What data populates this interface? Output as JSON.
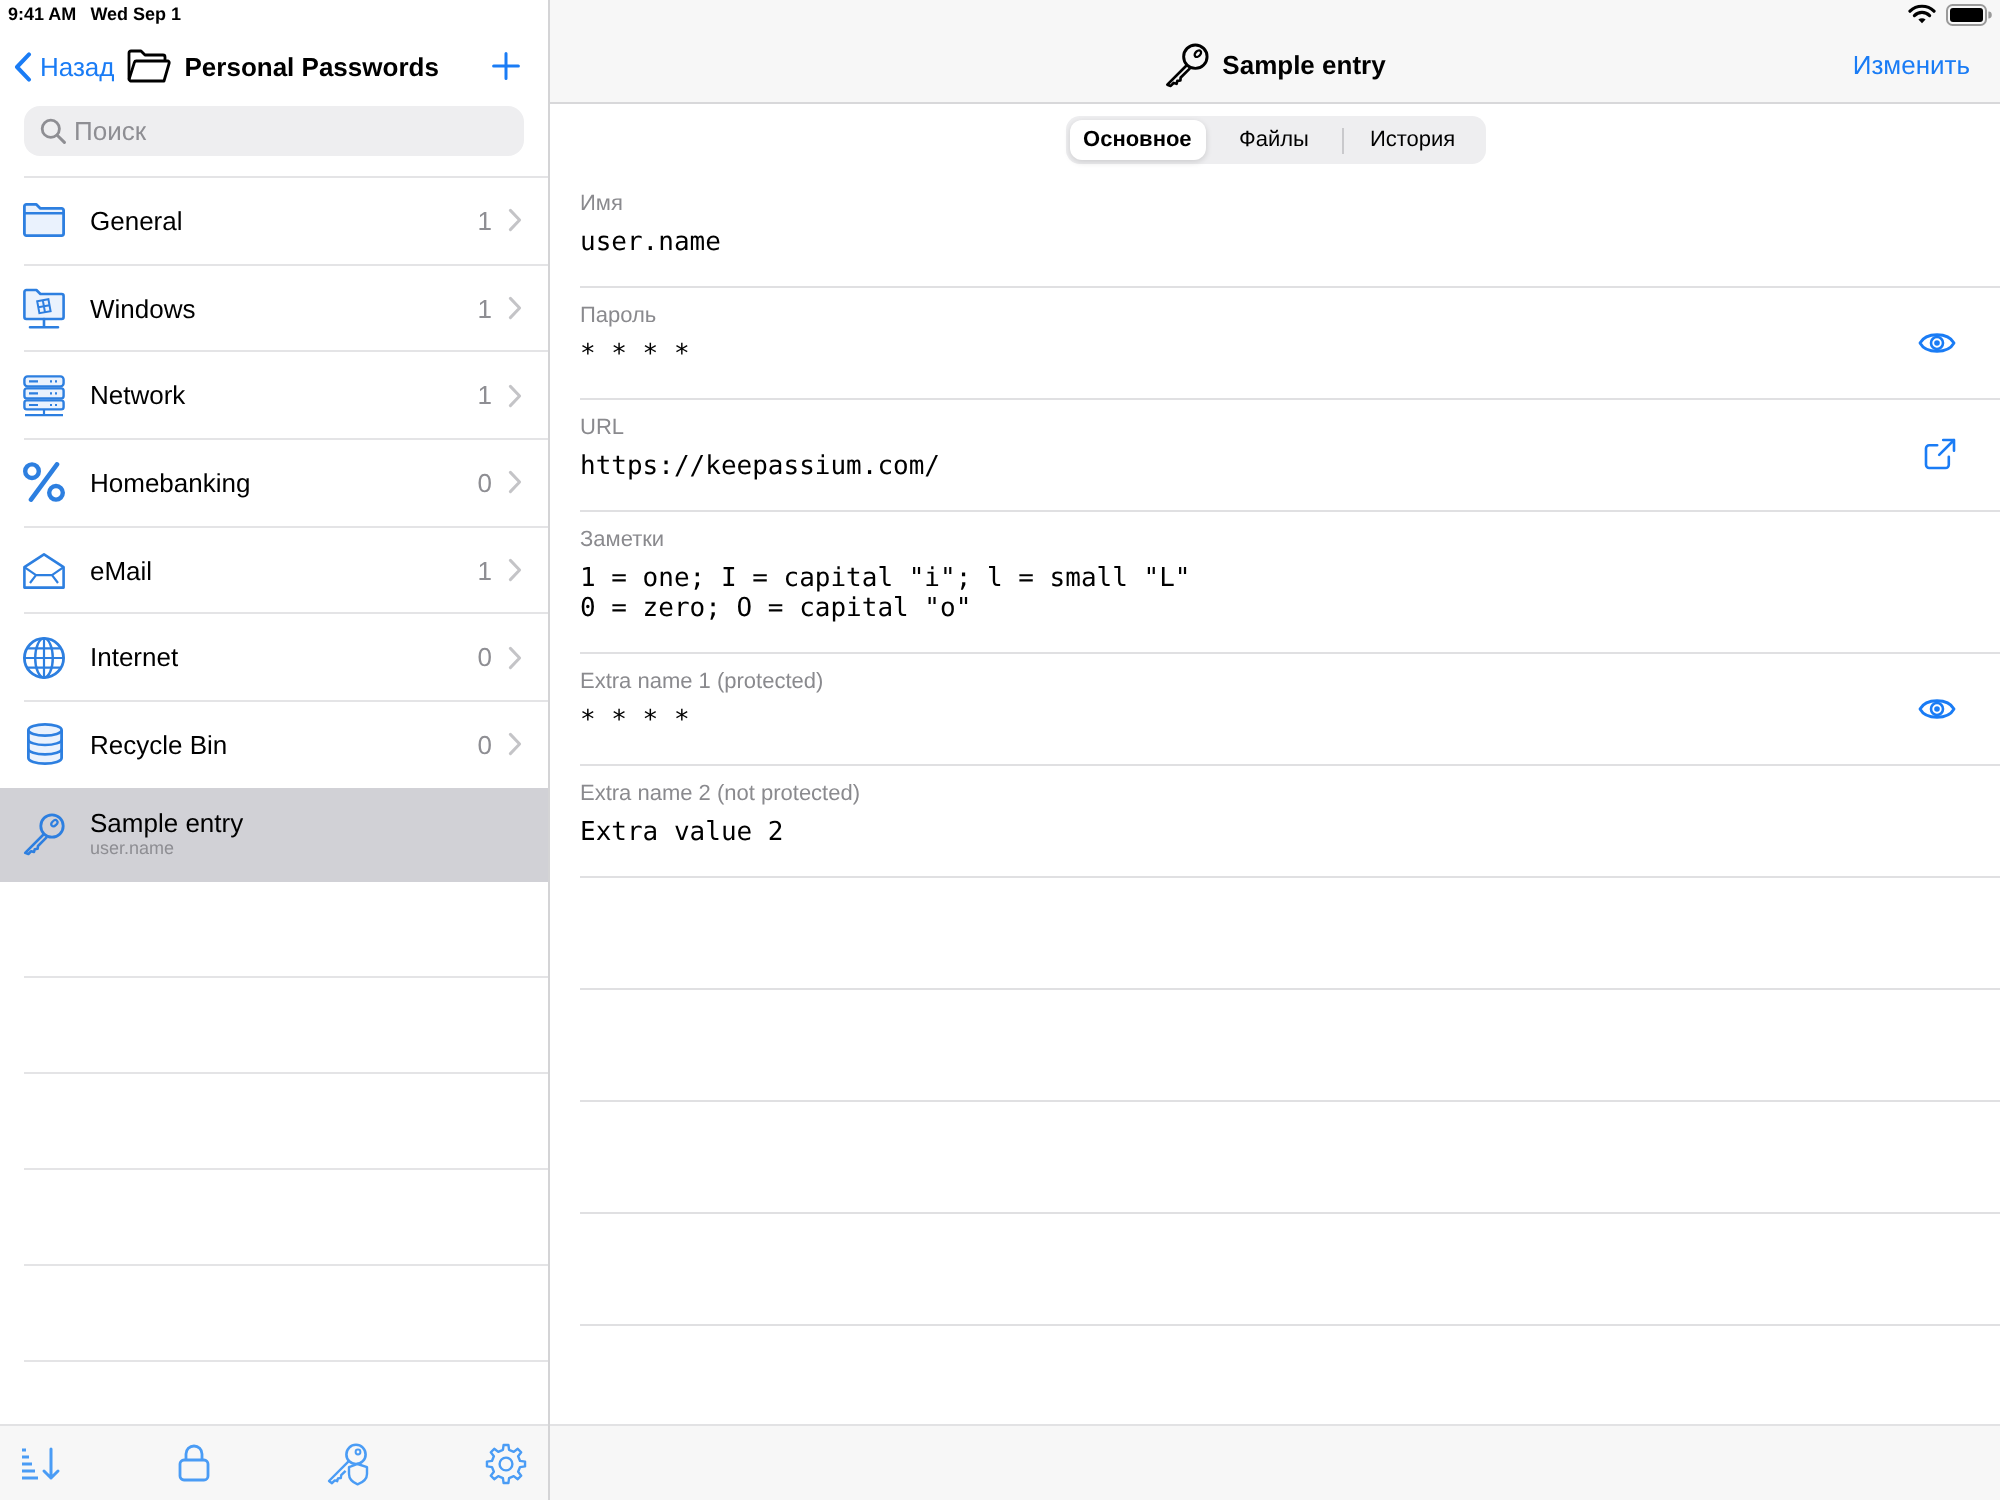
{
  "status_bar": {
    "time": "9:41 AM",
    "date": "Wed Sep 1"
  },
  "sidebar": {
    "back": "Назад",
    "title": "Personal Passwords",
    "search": {
      "placeholder": "Поиск"
    },
    "items": [
      {
        "kind": "group",
        "name": "General",
        "count": "1",
        "selected": false
      },
      {
        "kind": "group",
        "name": "Windows",
        "count": "1",
        "selected": false
      },
      {
        "kind": "group",
        "name": "Network",
        "count": "1",
        "selected": false
      },
      {
        "kind": "group",
        "name": "Homebanking",
        "count": "0",
        "selected": false
      },
      {
        "kind": "group",
        "name": "eMail",
        "count": "1",
        "selected": false
      },
      {
        "kind": "group",
        "name": "Internet",
        "count": "0",
        "selected": false
      },
      {
        "kind": "group",
        "name": "Recycle Bin",
        "count": "0",
        "selected": false
      },
      {
        "kind": "entry",
        "name": "Sample entry",
        "subtitle": "user.name",
        "selected": true
      }
    ]
  },
  "entry": {
    "title": "Sample entry",
    "edit": "Изменить",
    "tabs": [
      {
        "label": "Основное",
        "selected": true
      },
      {
        "label": "Файлы",
        "selected": false
      },
      {
        "label": "История",
        "selected": false
      }
    ],
    "fields": [
      {
        "kind": "text",
        "label": "Имя",
        "value": "user.name"
      },
      {
        "kind": "protected",
        "label": "Пароль",
        "value": "* * * *"
      },
      {
        "kind": "url",
        "label": "URL",
        "value": "https://keepassium.com/"
      },
      {
        "kind": "text",
        "label": "Заметки",
        "value": "1 = one; I = capital \"i\"; l = small \"L\"\n0 = zero; O = capital \"o\""
      },
      {
        "kind": "protected",
        "label": "Extra name 1 (protected)",
        "value": "* * * *"
      },
      {
        "kind": "text",
        "label": "Extra name 2 (not protected)",
        "value": "Extra value 2"
      }
    ]
  }
}
